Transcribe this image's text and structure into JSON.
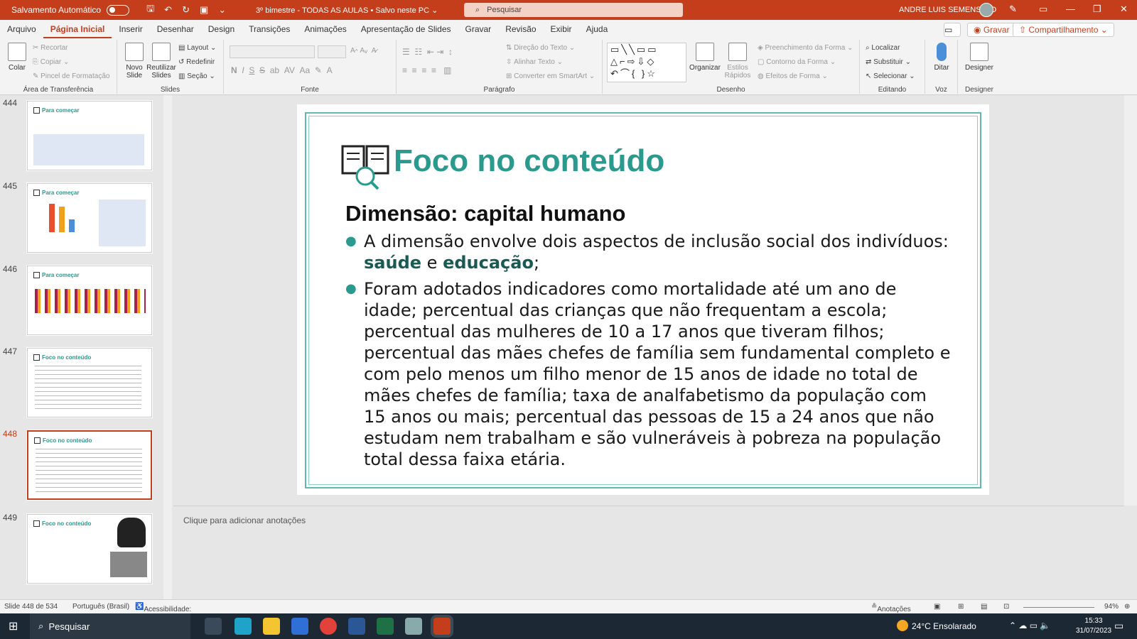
{
  "titlebar": {
    "autosave_label": "Salvamento Automático",
    "doc_title": "3º bimestre - TODAS AS AULAS  •  Salvo neste PC ⌄",
    "search_placeholder": "Pesquisar",
    "user_name": "ANDRE LUIS SEMENSATO"
  },
  "menu": {
    "tabs": [
      "Arquivo",
      "Página Inicial",
      "Inserir",
      "Desenhar",
      "Design",
      "Transições",
      "Animações",
      "Apresentação de Slides",
      "Gravar",
      "Revisão",
      "Exibir",
      "Ajuda"
    ],
    "active": "Página Inicial",
    "record": "Gravar",
    "share": "Compartilhamento"
  },
  "ribbon": {
    "clipboard": {
      "paste": "Colar",
      "cut": "Recortar",
      "copy": "Copiar",
      "format_painter": "Pincel de Formatação",
      "label": "Área de Transferência"
    },
    "slides": {
      "new_slide": "Novo Slide",
      "reuse": "Reutilizar Slides",
      "layout": "Layout",
      "reset": "Redefinir",
      "section": "Seção",
      "label": "Slides"
    },
    "font": {
      "label": "Fonte"
    },
    "paragraph": {
      "direction": "Direção do Texto",
      "align": "Alinhar Texto",
      "smartart": "Converter em SmartArt",
      "label": "Parágrafo"
    },
    "drawing": {
      "arrange": "Organizar",
      "quick_styles": "Estilos Rápidos",
      "fill": "Preenchimento da Forma",
      "outline": "Contorno da Forma",
      "effects": "Efeitos de Forma",
      "label": "Desenho"
    },
    "editing": {
      "find": "Localizar",
      "replace": "Substituir",
      "select": "Selecionar",
      "label": "Editando"
    },
    "voice": {
      "dictate": "Ditar",
      "label": "Voz"
    },
    "designer": {
      "btn": "Designer",
      "label": "Designer"
    }
  },
  "thumbnails": [
    {
      "num": "444",
      "title": "Para começar"
    },
    {
      "num": "445",
      "title": "Para começar"
    },
    {
      "num": "446",
      "title": "Para começar"
    },
    {
      "num": "447",
      "title": "Foco no conteúdo"
    },
    {
      "num": "448",
      "title": "Foco no conteúdo"
    },
    {
      "num": "449",
      "title": "Foco no conteúdo"
    }
  ],
  "slide": {
    "title": "Foco no conteúdo",
    "subtitle": "Dimensão: capital humano",
    "bullet1_pre": "A dimensão envolve dois aspectos de inclusão social dos indivíduos: ",
    "bullet1_kw1": "saúde",
    "bullet1_mid": " e ",
    "bullet1_kw2": "educação",
    "bullet1_post": ";",
    "bullet2": "Foram adotados indicadores como mortalidade até um ano de idade; percentual das crianças que não frequentam a escola; percentual das mulheres de 10 a 17 anos que tiveram filhos; percentual das mães chefes de família sem fundamental completo e com pelo menos um filho menor de 15 anos de idade no total de mães chefes de família; taxa de analfabetismo da população com 15 anos ou mais; percentual das pessoas de 15 a 24 anos que não estudam nem trabalham e são vulneráveis à pobreza na população total dessa faixa etária."
  },
  "notes_placeholder": "Clique para adicionar anotações",
  "status": {
    "slide_count": "Slide 448 de 534",
    "language": "Português (Brasil)",
    "accessibility": "Acessibilidade: investigar",
    "notes_btn": "Anotações",
    "zoom": "94%"
  },
  "taskbar": {
    "search": "Pesquisar",
    "weather": "24°C  Ensolarado",
    "time": "15:33",
    "date": "31/07/2023"
  }
}
